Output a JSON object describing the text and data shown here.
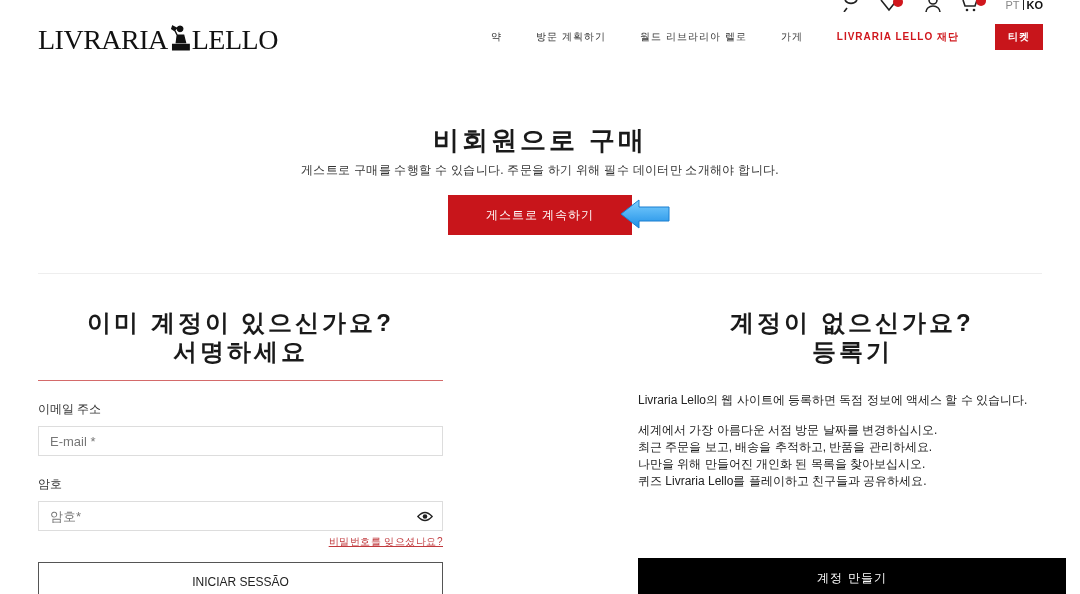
{
  "header": {
    "logo": "LIVRARIA",
    "logo_2": "LELLO",
    "languages": [
      {
        "label": "PT",
        "selected": false
      },
      {
        "label": "KO",
        "selected": true
      }
    ],
    "nav": [
      {
        "label": "약",
        "kind": "link"
      },
      {
        "label": "방문 계획하기",
        "kind": "link"
      },
      {
        "label": "월드 리브라리아 렐로",
        "kind": "link"
      },
      {
        "label": "가게",
        "kind": "link"
      },
      {
        "label": "LIVRARIA LELLO 재단",
        "kind": "highlight"
      },
      {
        "label": "티켓",
        "kind": "button"
      }
    ]
  },
  "guest": {
    "title": "비회원으로 구매",
    "text": "게스트로 구매를 수행할 수 있습니다. 주문을 하기 위해 필수 데이터만 소개해야 합니다.",
    "button": "게스트로 계속하기"
  },
  "login": {
    "title": "이미 계정이 있으신가요?",
    "title_2": "서명하세요",
    "email_label": "이메일 주소",
    "email_placeholder": "E-mail *",
    "password_label": "암호",
    "password_placeholder": "암호*",
    "forgot": "비밀번호를 잊으셨나요?",
    "button": "INICIAR SESSÃO"
  },
  "register": {
    "title": "계정이 없으신가요?",
    "title_2": "등록기",
    "intro": "Livraria Lello의 웹 사이트에 등록하면 독점 정보에 액세스 할 수 있습니다.",
    "benefits": [
      "세계에서 가장 아름다운 서점 방문 날짜를 변경하십시오.",
      "최근 주문을 보고, 배송을 추적하고, 반품을 관리하세요.",
      "나만을 위해 만들어진 개인화 된 목록을 찾아보십시오.",
      "퀴즈 Livraria Lello를 플레이하고 친구들과 공유하세요."
    ],
    "button": "계정 만들기"
  }
}
